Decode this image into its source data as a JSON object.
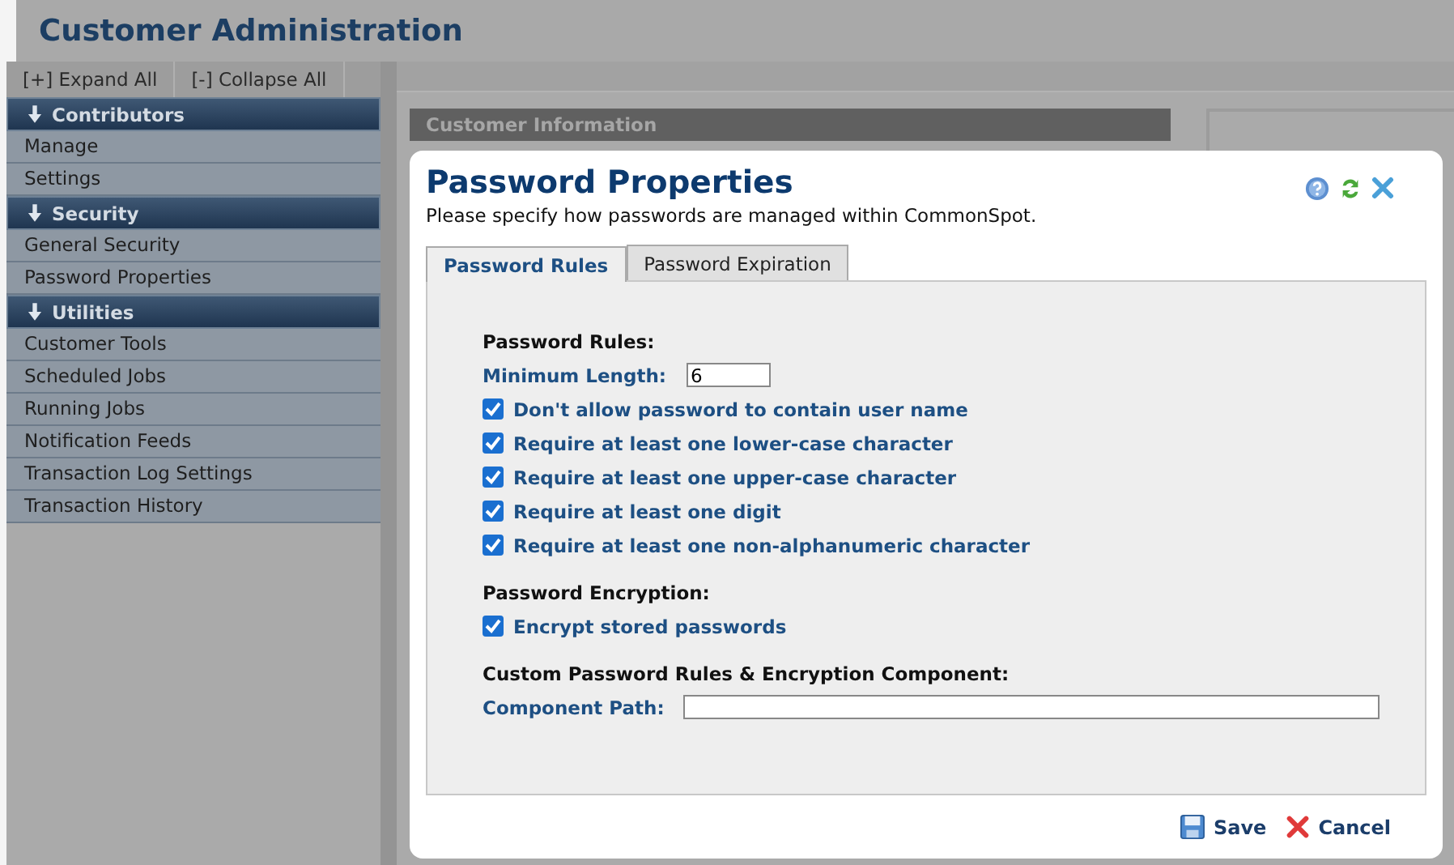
{
  "header": {
    "title": "Customer Administration"
  },
  "sidebar": {
    "toolbar": [
      "[+] Expand All",
      "[-] Collapse All"
    ],
    "sections": [
      {
        "title": "Contributors",
        "expanded": true,
        "items": [
          "Manage",
          "Settings"
        ]
      },
      {
        "title": "Security",
        "expanded": true,
        "items": [
          "General Security",
          "Password Properties"
        ]
      },
      {
        "title": "Utilities",
        "expanded": true,
        "items": [
          "Customer Tools",
          "Scheduled Jobs",
          "Running Jobs",
          "Notification Feeds",
          "Transaction Log Settings",
          "Transaction History"
        ]
      }
    ]
  },
  "background": {
    "panel_title": "Customer Information"
  },
  "dialog": {
    "title": "Password Properties",
    "subtitle": "Please specify how passwords are managed within CommonSpot.",
    "tabs": [
      {
        "label": "Password Rules",
        "selected": true
      },
      {
        "label": "Password Expiration",
        "selected": false
      }
    ],
    "groups": [
      {
        "heading": "Password Rules:",
        "rows": [
          {
            "kind": "field",
            "label": "Minimum Length:",
            "value": "6"
          },
          {
            "kind": "checkbox",
            "label": "Don't allow password to contain user name",
            "checked": true
          },
          {
            "kind": "checkbox",
            "label": "Require at least one lower-case character",
            "checked": true
          },
          {
            "kind": "checkbox",
            "label": "Require at least one upper-case character",
            "checked": true
          },
          {
            "kind": "checkbox",
            "label": "Require at least one digit",
            "checked": true
          },
          {
            "kind": "checkbox",
            "label": "Require at least one non-alphanumeric character",
            "checked": true
          }
        ]
      },
      {
        "heading": "Password Encryption:",
        "rows": [
          {
            "kind": "checkbox",
            "label": "Encrypt stored passwords",
            "checked": true
          }
        ]
      },
      {
        "heading": "Custom Password Rules & Encryption Component:",
        "rows": [
          {
            "kind": "field",
            "label": "Component Path:"
          }
        ]
      }
    ],
    "buttons": [
      {
        "kind": "save",
        "label": "Save"
      },
      {
        "kind": "cancel",
        "label": "Cancel"
      }
    ]
  }
}
